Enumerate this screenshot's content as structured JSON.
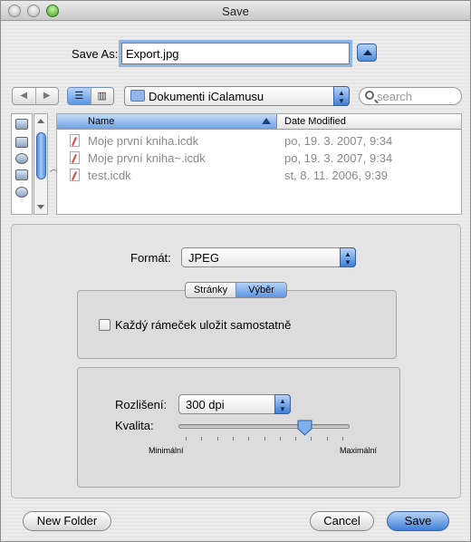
{
  "window": {
    "title": "Save"
  },
  "saveas": {
    "label": "Save As:",
    "value": "Export.jpg"
  },
  "toolbar": {
    "location": "Dokumenti iCalamusu",
    "search_placeholder": "search"
  },
  "filelist": {
    "columns": [
      "Name",
      "Date Modified"
    ],
    "rows": [
      {
        "name": "Moje první kniha.icdk",
        "date": "po, 19. 3. 2007, 9:34"
      },
      {
        "name": "Moje první kniha~.icdk",
        "date": "po, 19. 3. 2007, 9:34"
      },
      {
        "name": "test.icdk",
        "date": "st, 8. 11. 2006, 9:39"
      }
    ]
  },
  "options": {
    "format_label": "Formát:",
    "format_value": "JPEG",
    "tabs": [
      "Stránky",
      "Výběr"
    ],
    "selected_tab": "Výběr",
    "checkbox_label": "Každý rámeček uložit samostatně",
    "checkbox_checked": false,
    "resolution_label": "Rozlišení:",
    "resolution_value": "300 dpi",
    "quality_label": "Kvalita:",
    "quality_level": 0.76,
    "quality_min": "Minimální",
    "quality_max": "Maximální"
  },
  "buttons": {
    "new_folder": "New Folder",
    "cancel": "Cancel",
    "save": "Save"
  },
  "colors": {
    "accent": "#4f8de0"
  }
}
